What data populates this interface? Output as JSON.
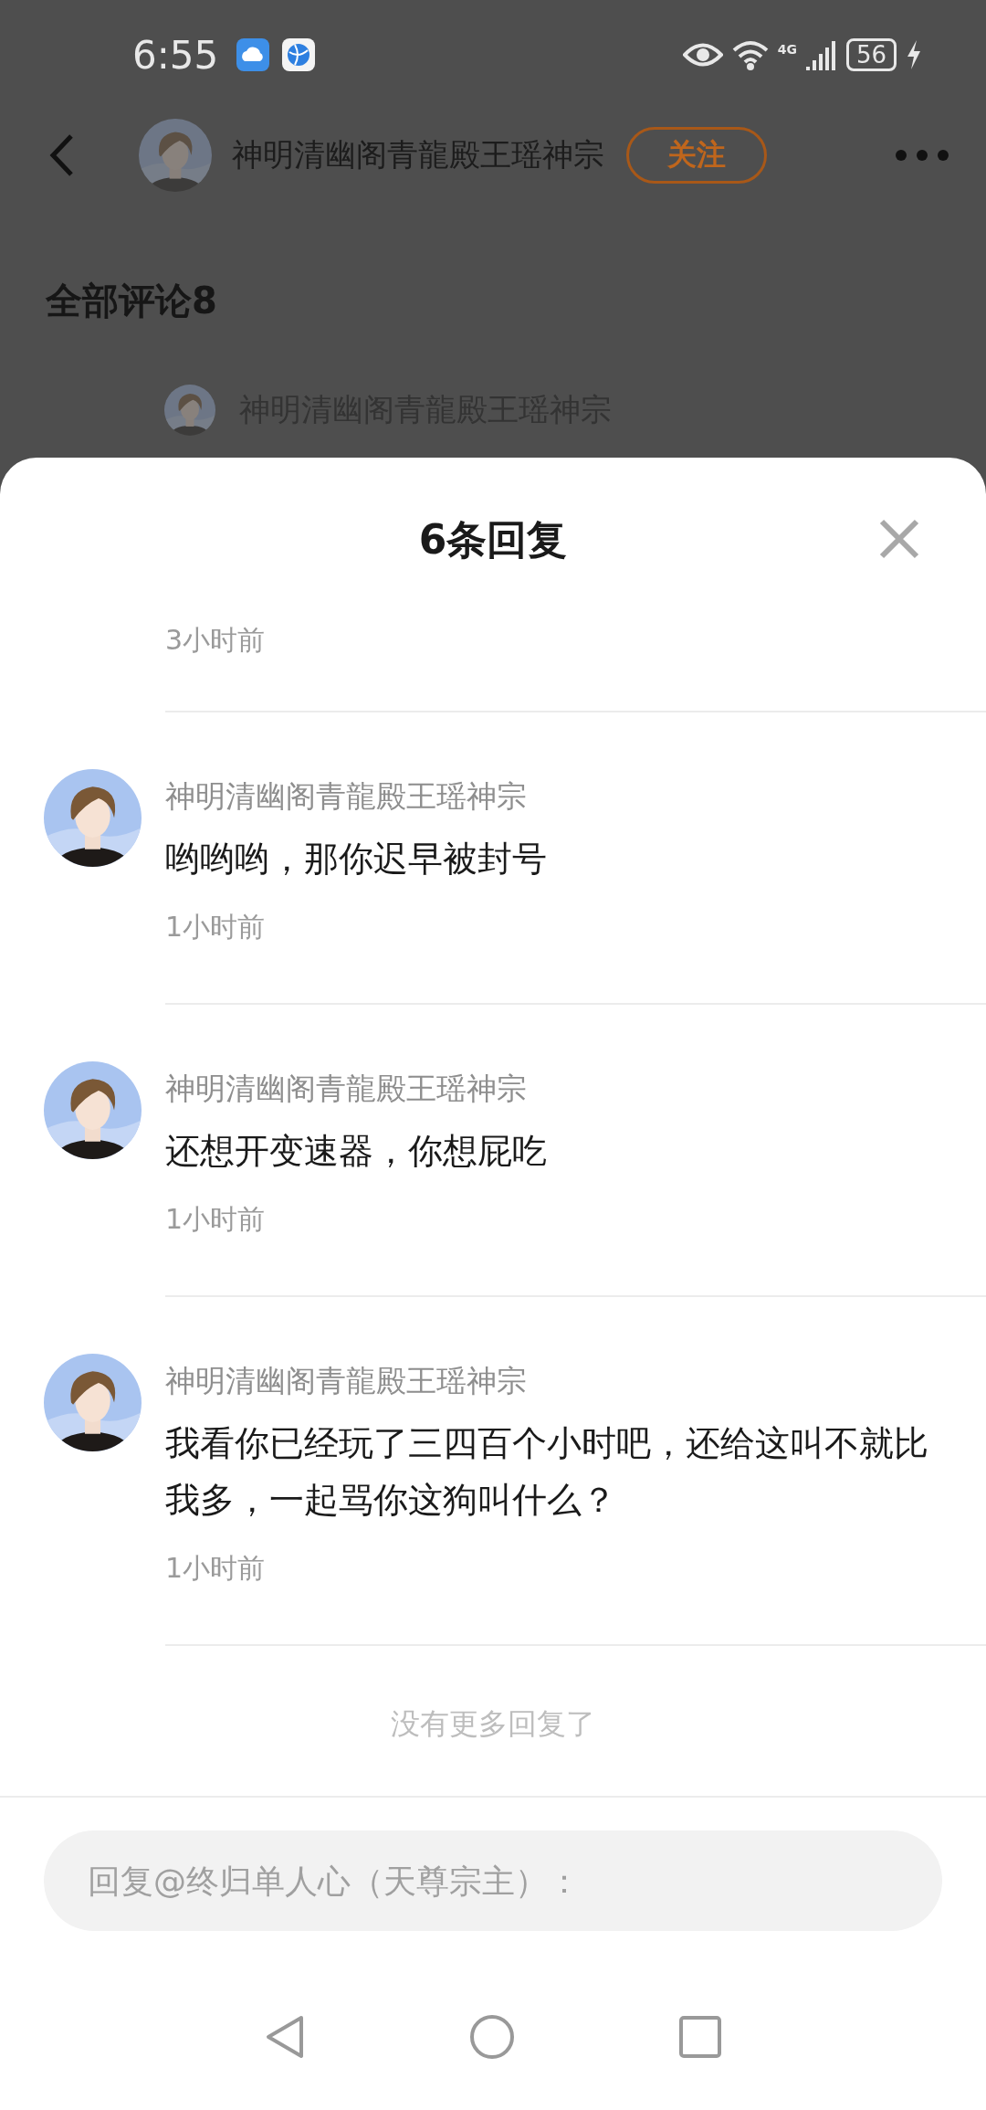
{
  "status_bar": {
    "time": "6:55",
    "network": "4G",
    "battery": "56"
  },
  "header": {
    "author": "神明清幽阁青龍殿王瑶神宗",
    "follow_button": "关注"
  },
  "comments_section": {
    "title": "全部评论8",
    "preview_author": "神明清幽阁青龍殿王瑶神宗"
  },
  "sheet": {
    "title": "6条回复",
    "previous_time": "3小时前",
    "replies": [
      {
        "author": "神明清幽阁青龍殿王瑶神宗",
        "text": "哟哟哟，那你迟早被封号",
        "time": "1小时前"
      },
      {
        "author": "神明清幽阁青龍殿王瑶神宗",
        "text": "还想开变速器，你想屁吃",
        "time": "1小时前"
      },
      {
        "author": "神明清幽阁青龍殿王瑶神宗",
        "text": "我看你已经玩了三四百个小时吧，还给这叫不就比我多，一起骂你这狗叫什么？",
        "time": "1小时前"
      }
    ],
    "end_note": "没有更多回复了"
  },
  "reply_box": {
    "placeholder": "回复@终归单人心（天尊宗主）："
  }
}
